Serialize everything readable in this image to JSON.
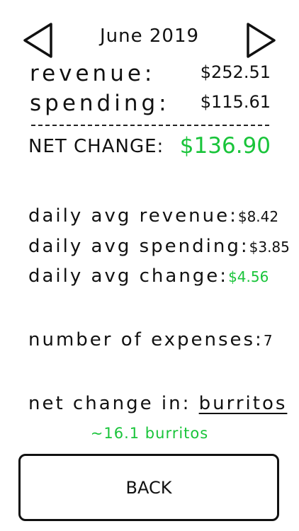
{
  "header": {
    "month": "June 2019",
    "prev_icon": "triangle-left-icon",
    "next_icon": "triangle-right-icon"
  },
  "summary": {
    "revenue_label": "revenue:",
    "revenue_value": "$252.51",
    "spending_label": "spending:",
    "spending_value": "$115.61",
    "net_label": "NET CHANGE:",
    "net_value": "$136.90"
  },
  "stats": {
    "avg_revenue_label": "daily avg revenue:",
    "avg_revenue_value": "$8.42",
    "avg_spending_label": "daily avg spending:",
    "avg_spending_value": "$3.85",
    "avg_change_label": "daily avg change:",
    "avg_change_value": "$4.56",
    "expenses_label": "number of expenses:",
    "expenses_value": "7"
  },
  "conversion": {
    "label": "net change in:",
    "unit": "burritos",
    "result": "~16.1 burritos"
  },
  "footer": {
    "back_label": "BACK"
  },
  "colors": {
    "positive": "#19c43a",
    "ink": "#111111"
  }
}
